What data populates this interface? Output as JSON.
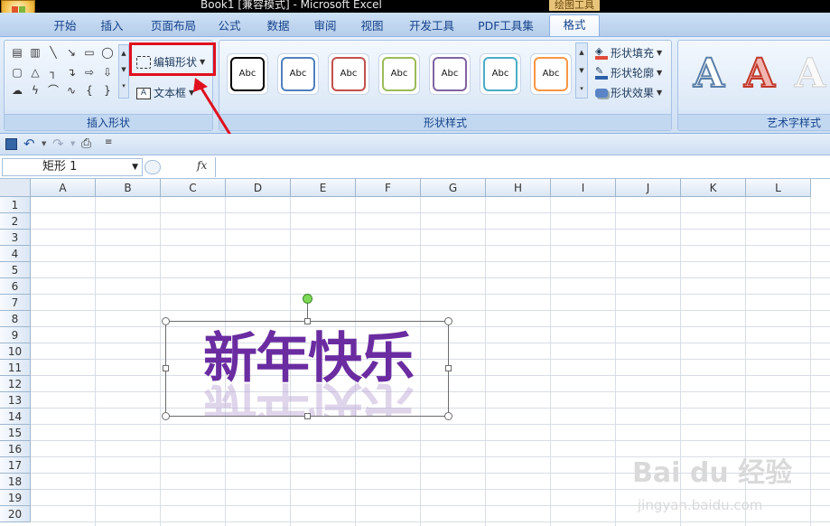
{
  "window": {
    "title": "Book1 [兼容模式] - Microsoft Excel",
    "context_tab_label": "绘图工具"
  },
  "tabs": [
    "开始",
    "插入",
    "页面布局",
    "公式",
    "数据",
    "审阅",
    "视图",
    "开发工具",
    "PDF工具集",
    "格式"
  ],
  "active_tab": "格式",
  "ribbon": {
    "insert_shapes": {
      "label": "插入形状",
      "edit_shape": "编辑形状",
      "text_box": "文本框"
    },
    "shape_styles": {
      "label": "形状样式",
      "style_text": "Abc",
      "fill": "形状填充",
      "outline": "形状轮廓",
      "effects": "形状效果",
      "style_colors": [
        "#000000",
        "#4f81bd",
        "#c0504d",
        "#9bbb59",
        "#8064a2",
        "#4bacc6",
        "#f79646"
      ]
    },
    "wordart_styles": {
      "label": "艺术字样式",
      "sample": "A"
    }
  },
  "name_box": "矩形 1",
  "formula_fx": "fx",
  "columns": [
    "A",
    "B",
    "C",
    "D",
    "E",
    "F",
    "G",
    "H",
    "I",
    "J",
    "K",
    "L"
  ],
  "rows": [
    "1",
    "2",
    "3",
    "4",
    "5",
    "6",
    "7",
    "8",
    "9",
    "10",
    "11",
    "12",
    "13",
    "14",
    "15",
    "16",
    "17",
    "18",
    "19",
    "20"
  ],
  "shape_text": "新年快乐",
  "colors": {
    "highlight": "#e0101e",
    "shape_text": "#6a2ca0"
  },
  "watermark": {
    "brand": "Bai du 经验",
    "url": "jingyan.baidu.com"
  }
}
